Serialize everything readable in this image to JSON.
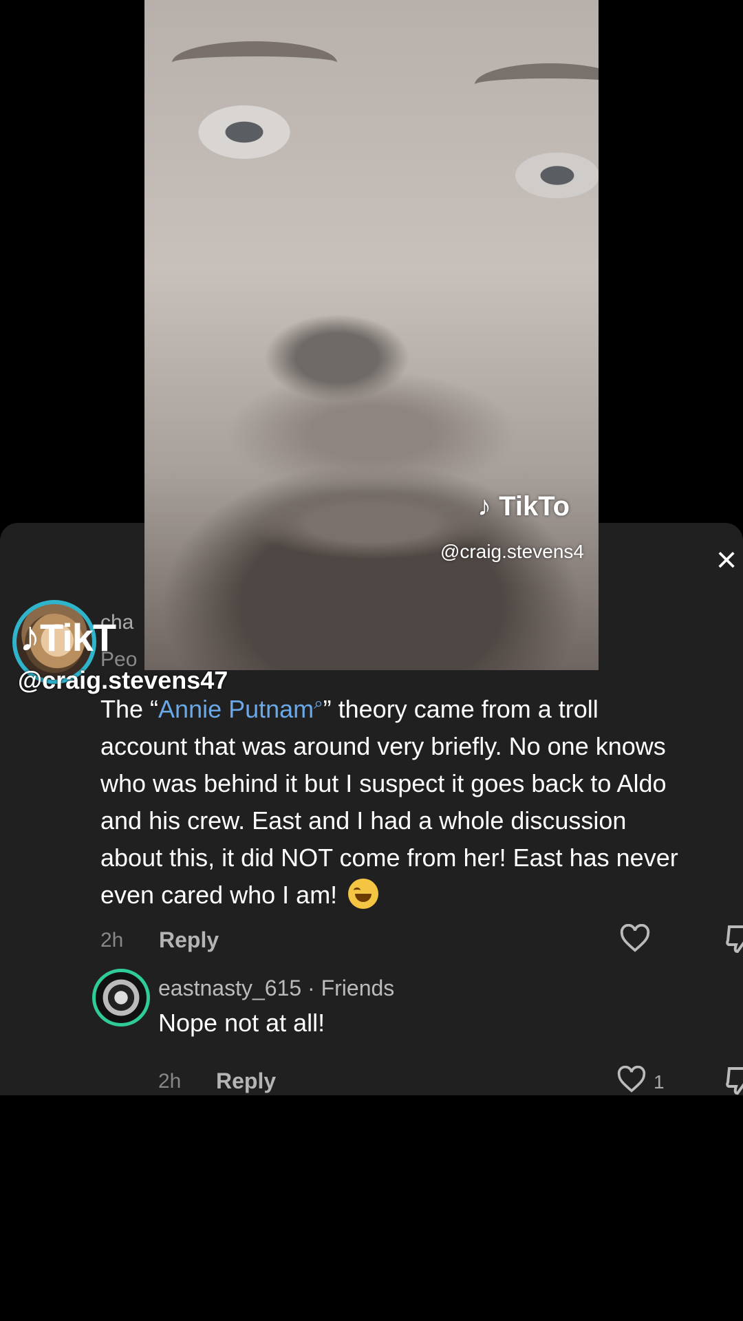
{
  "colors": {
    "sheet_bg": "#202020",
    "mention": "#6aa9e9",
    "avatar_ring_main": "#2fb4cc",
    "avatar_ring_reply": "#2fcc9a"
  },
  "overlay": {
    "brand": "TikT",
    "handle": "@craig.stevens47"
  },
  "video": {
    "brand": "TikTo",
    "handle": "@craig.stevens4"
  },
  "sheet": {
    "close_icon": "×",
    "comment": {
      "author_partial": "cha",
      "author_sub_partial": "Peo",
      "text_prefix": "The “",
      "mention": "Annie Putnam",
      "search_glyph": "⌕",
      "text_line1_rest": "” theory came from a troll",
      "line2": "account that was around very briefly. No one knows",
      "line3": "who was behind it but I suspect it goes back to Aldo",
      "line4": "and his crew. East and I had a whole discussion",
      "line5": "about this, it did NOT come from her! East has never",
      "line6": "even cared who I am!",
      "emoji": "laughing-emoji",
      "time": "2h",
      "reply_label": "Reply"
    },
    "reply": {
      "author": "eastnasty_615 · Friends",
      "text": "Nope not at all!",
      "time": "2h",
      "reply_label": "Reply",
      "like_count": "1"
    }
  }
}
